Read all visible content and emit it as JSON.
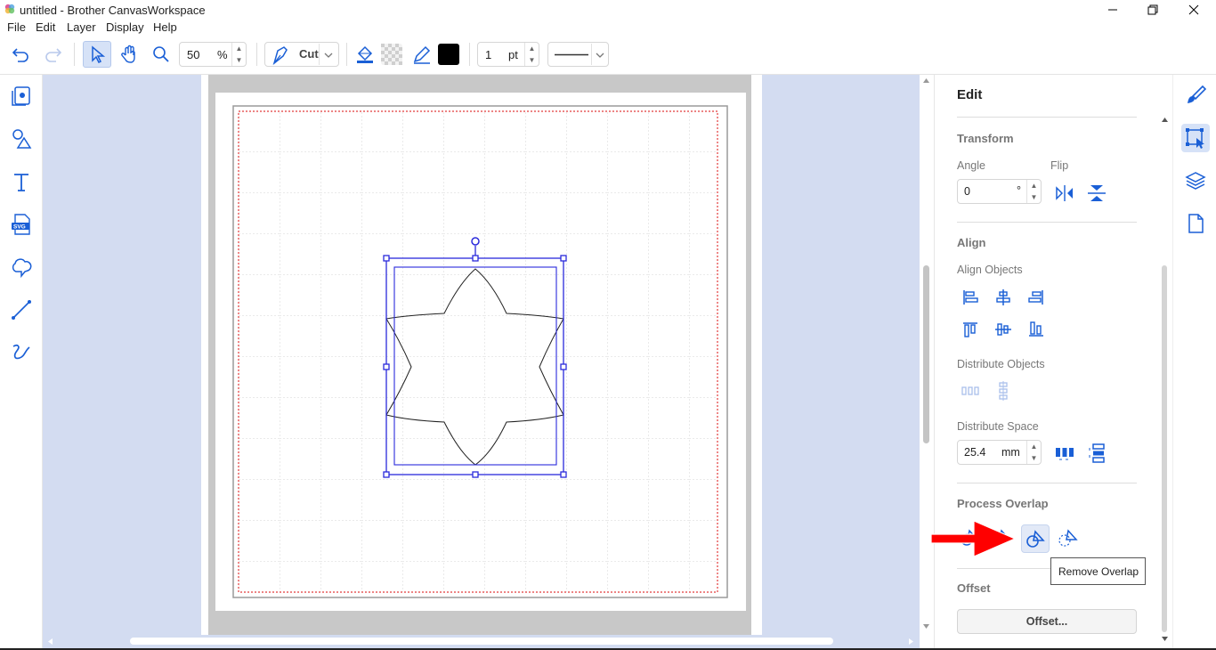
{
  "window": {
    "title": "untitled - Brother CanvasWorkspace"
  },
  "menu": [
    "File",
    "Edit",
    "Layer",
    "Display",
    "Help"
  ],
  "toolbar": {
    "zoom_value": "50",
    "zoom_unit": "%",
    "mode_label": "Cut",
    "line_width_value": "1",
    "line_width_unit": "pt",
    "stroke_color": "#000000",
    "accent_color": "#1a5fd6"
  },
  "panel": {
    "title": "Edit",
    "transform": {
      "header": "Transform",
      "angle_label": "Angle",
      "angle_value": "0",
      "angle_unit": "°",
      "flip_label": "Flip"
    },
    "align": {
      "header": "Align",
      "align_objects_label": "Align Objects",
      "distribute_objects_label": "Distribute Objects",
      "distribute_space_label": "Distribute Space",
      "distribute_space_value": "25.4",
      "distribute_space_unit": "mm"
    },
    "process_overlap": {
      "header": "Process Overlap"
    },
    "offset": {
      "header": "Offset",
      "button_label": "Offset..."
    }
  },
  "tooltip": "Remove Overlap",
  "left_tools": [
    "project-icon",
    "shapes-icon",
    "text-icon",
    "svg-import-icon",
    "cloud-shape-icon",
    "line-icon",
    "freehand-icon"
  ],
  "right_tabs": [
    "paint-brush-icon",
    "edit-transform-icon",
    "layers-icon",
    "page-icon"
  ]
}
